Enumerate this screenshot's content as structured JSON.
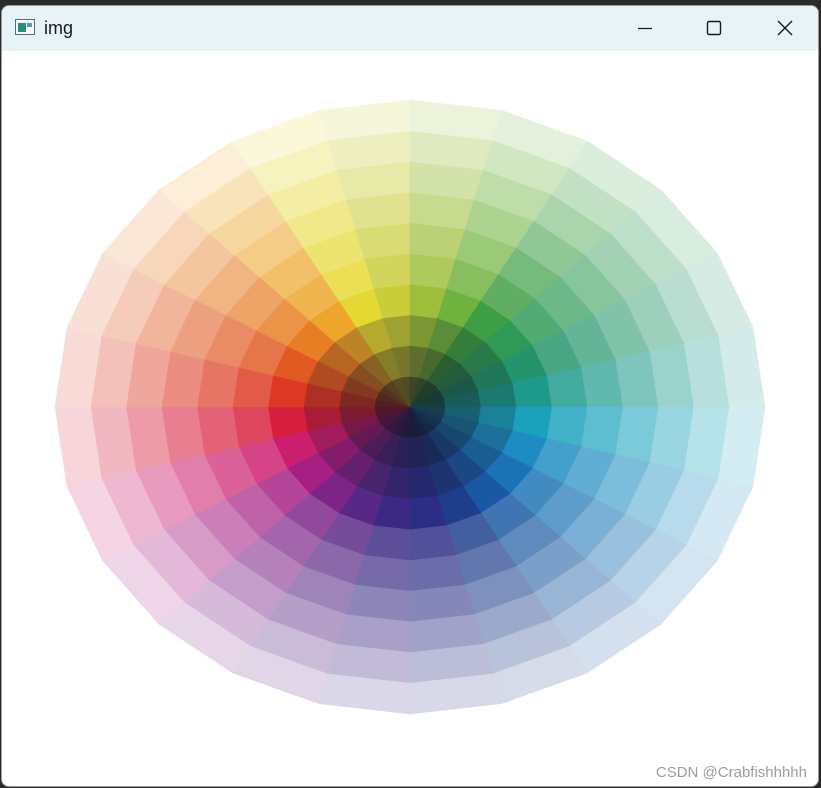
{
  "window": {
    "title": "img",
    "icon": "app-image-icon",
    "controls": {
      "minimize_icon": "minimize-icon",
      "maximize_icon": "maximize-icon",
      "close_icon": "close-icon"
    }
  },
  "image": {
    "description_icon": "color-wheel-image",
    "hue_sectors": 24,
    "rings": 10,
    "hues": [
      {
        "name": "yellow",
        "color": "#e6d832"
      },
      {
        "name": "yellow-green",
        "color": "#c9cd3a"
      },
      {
        "name": "green-yellow",
        "color": "#9dbe3b"
      },
      {
        "name": "light-green",
        "color": "#6fb23e"
      },
      {
        "name": "green",
        "color": "#3e9e44"
      },
      {
        "name": "green-2",
        "color": "#2e9a55"
      },
      {
        "name": "sea-green",
        "color": "#23946c"
      },
      {
        "name": "teal-green",
        "color": "#1d9a8c"
      },
      {
        "name": "teal",
        "color": "#1aa2bd"
      },
      {
        "name": "cyan-blue",
        "color": "#1d8cc2"
      },
      {
        "name": "blue",
        "color": "#1a73b5"
      },
      {
        "name": "blue-2",
        "color": "#1b58a3"
      },
      {
        "name": "navy",
        "color": "#1e3e8c"
      },
      {
        "name": "indigo",
        "color": "#2c2e85"
      },
      {
        "name": "blue-violet",
        "color": "#3b2a84"
      },
      {
        "name": "violet",
        "color": "#582886"
      },
      {
        "name": "purple",
        "color": "#7c2487"
      },
      {
        "name": "magenta-purple",
        "color": "#a61f83"
      },
      {
        "name": "magenta",
        "color": "#cc1e6e"
      },
      {
        "name": "crimson",
        "color": "#d71f3d"
      },
      {
        "name": "red",
        "color": "#dc3a24"
      },
      {
        "name": "red-orange",
        "color": "#e05a22"
      },
      {
        "name": "orange",
        "color": "#e77e23"
      },
      {
        "name": "orange-yellow",
        "color": "#eda62a"
      }
    ]
  },
  "watermark": "CSDN @Crabfishhhhh"
}
